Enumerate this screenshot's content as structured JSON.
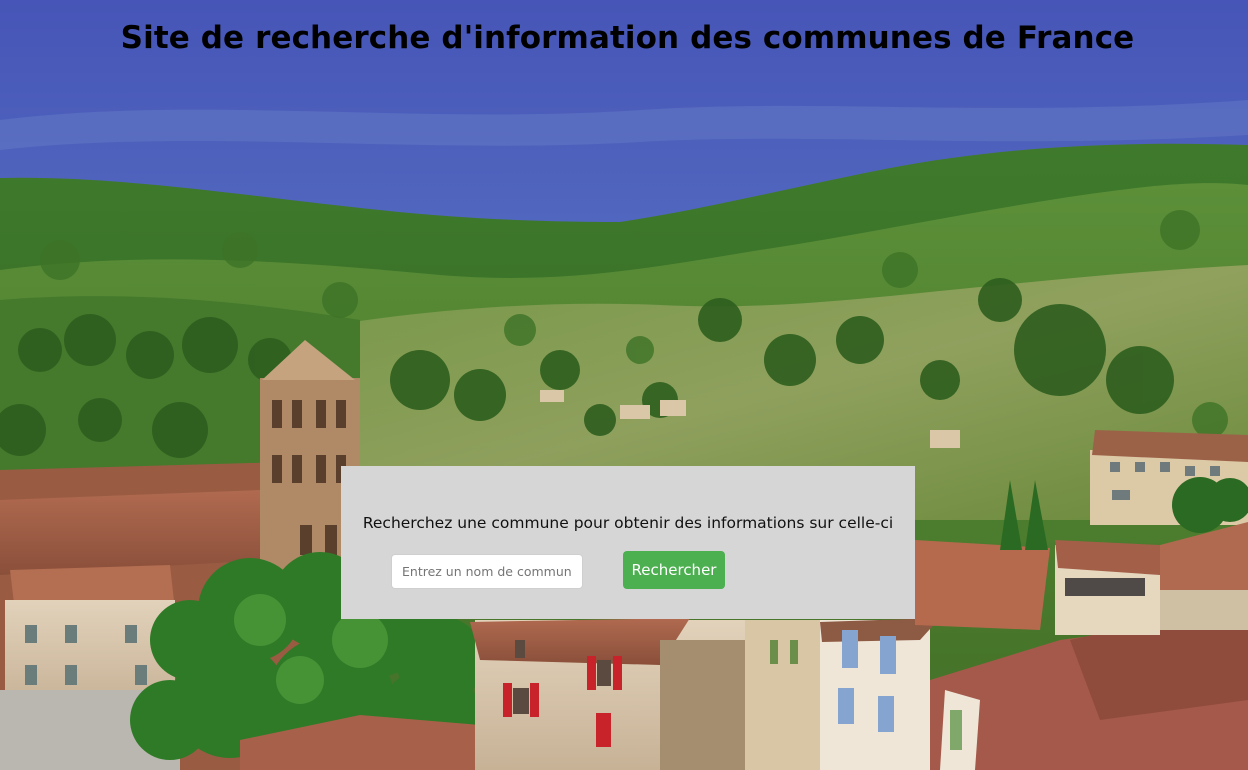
{
  "header": {
    "title": "Site de recherche d'information des communes de France"
  },
  "search": {
    "prompt": "Recherchez une commune pour obtenir des informations sur celle-ci",
    "placeholder": "Entrez un nom de commune",
    "button_label": "Rechercher"
  },
  "colors": {
    "panel_background": "#d6d6d6",
    "button_background": "#4caf50",
    "button_text": "#ffffff"
  }
}
